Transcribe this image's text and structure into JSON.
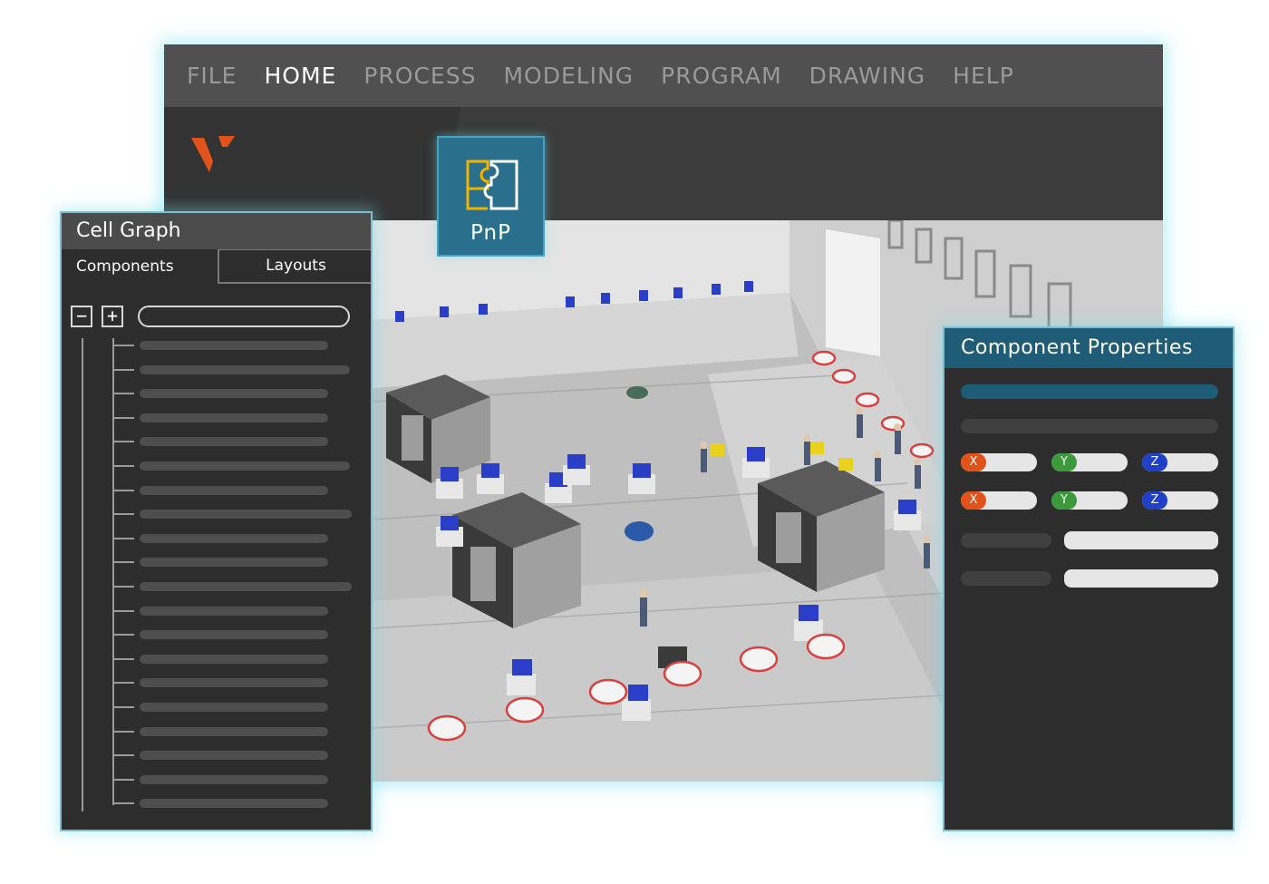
{
  "menu": {
    "items": [
      "FILE",
      "HOME",
      "PROCESS",
      "MODELING",
      "PROGRAM",
      "DRAWING",
      "HELP"
    ],
    "active_index": 1
  },
  "ribbon": {
    "pnp_label": "PnP",
    "pnp_icon": "puzzle-icon"
  },
  "cell_graph": {
    "title": "Cell Graph",
    "tabs": {
      "components": "Components",
      "layouts": "Layouts"
    },
    "collapse_label": "−",
    "expand_label": "+",
    "search_placeholder": "",
    "item_count": 20
  },
  "component_properties": {
    "title": "Component Properties",
    "axes": {
      "x": "X",
      "y": "Y",
      "z": "Z"
    }
  },
  "colors": {
    "accent": "#1f5c78",
    "logo": "#e2531b",
    "glow": "#78e1f0",
    "axis_x": "#e2531b",
    "axis_y": "#3c9a3c",
    "axis_z": "#2040c8"
  }
}
